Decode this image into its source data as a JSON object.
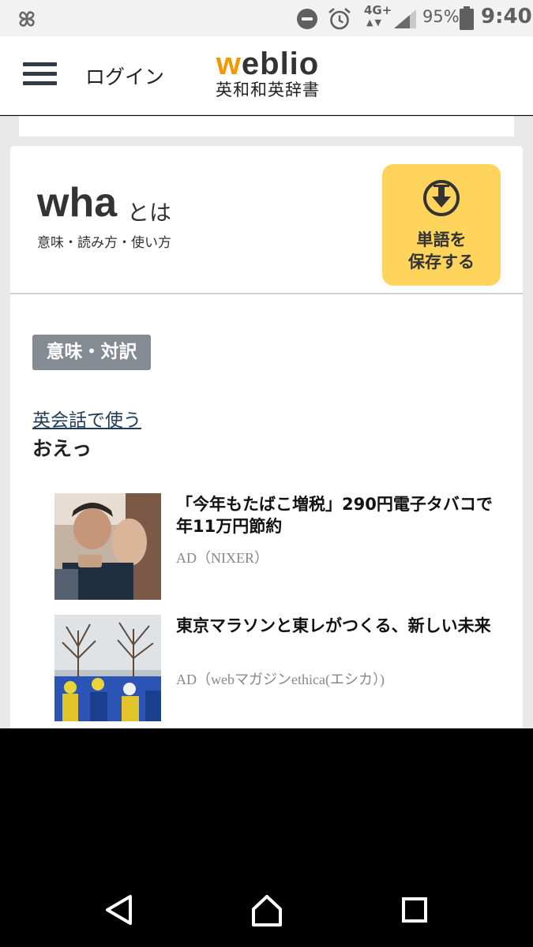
{
  "status_bar": {
    "network": "4G+",
    "network_arrows": "▲▼",
    "battery_percent": "95%",
    "time": "9:40",
    "icons": [
      "pinwheel-icon",
      "do-not-disturb-icon",
      "alarm-icon",
      "signal-icon",
      "battery-icon"
    ]
  },
  "header": {
    "login": "ログイン",
    "logo_word_first": "w",
    "logo_word_rest": "eblio",
    "logo_sub": "英和和英辞書"
  },
  "word": {
    "title": "wha",
    "toha": "とは",
    "subtitle": "意味・読み方・使い方",
    "save_label": "単語を\n保存する"
  },
  "meaning": {
    "badge": "意味・対訳",
    "conversation_link": "英会話で使う",
    "conversation_text": "おえっ"
  },
  "ads": [
    {
      "title": "「今年もたばこ増税」290円電子タバコで年11万円節約",
      "source": "AD（NIXER）"
    },
    {
      "title": "東京マラソンと東レがつくる、新しい未来",
      "source": "AD（webマガジンethica(エシカ）)"
    }
  ],
  "colors": {
    "accent_orange": "#f39800",
    "save_button": "#ffd45c",
    "badge_gray": "#858b92",
    "link_navy": "#1f3b57",
    "page_gray": "#e9e9e9"
  }
}
